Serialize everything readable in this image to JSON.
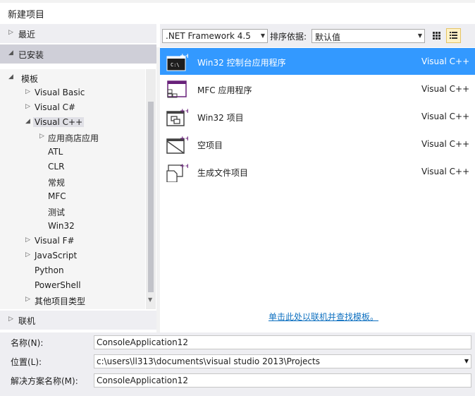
{
  "window": {
    "title": "新建项目"
  },
  "left": {
    "recent_label": "最近",
    "installed_label": "已安装",
    "online_label": "联机",
    "tree": [
      {
        "label": "模板",
        "arrow": "◢"
      },
      {
        "label": "Visual Basic",
        "arrow": "▷"
      },
      {
        "label": "Visual C#",
        "arrow": "▷"
      },
      {
        "label": "Visual C++",
        "arrow": "◢"
      },
      {
        "label": "应用商店应用",
        "arrow": "▷"
      },
      {
        "label": "ATL",
        "arrow": ""
      },
      {
        "label": "CLR",
        "arrow": ""
      },
      {
        "label": "常规",
        "arrow": ""
      },
      {
        "label": "MFC",
        "arrow": ""
      },
      {
        "label": "测试",
        "arrow": ""
      },
      {
        "label": "Win32",
        "arrow": ""
      },
      {
        "label": "Visual F#",
        "arrow": "▷"
      },
      {
        "label": "JavaScript",
        "arrow": "▷"
      },
      {
        "label": "Python",
        "arrow": ""
      },
      {
        "label": "PowerShell",
        "arrow": ""
      },
      {
        "label": "其他项目类型",
        "arrow": "▷"
      }
    ]
  },
  "toolbar": {
    "framework": ".NET Framework 4.5",
    "sort_label": "排序依据:",
    "sort_value": "默认值"
  },
  "templates": [
    {
      "name": "Win32 控制台应用程序",
      "lang": "Visual C++",
      "icon": "console-app-icon"
    },
    {
      "name": "MFC 应用程序",
      "lang": "Visual C++",
      "icon": "mfc-app-icon"
    },
    {
      "name": "Win32 项目",
      "lang": "Visual C++",
      "icon": "win32-project-icon"
    },
    {
      "name": "空项目",
      "lang": "Visual C++",
      "icon": "empty-project-icon"
    },
    {
      "name": "生成文件项目",
      "lang": "Visual C++",
      "icon": "makefile-project-icon"
    }
  ],
  "online_link": "单击此处以联机并查找模板。",
  "form": {
    "name_label": "名称(N):",
    "name_value": "ConsoleApplication12",
    "location_label": "位置(L):",
    "location_value": "c:\\users\\ll313\\documents\\visual studio 2013\\Projects",
    "solution_label": "解决方案名称(M):",
    "solution_value": "ConsoleApplication12"
  },
  "colors": {
    "selection": "#3399ff",
    "link": "#0e70c0",
    "panel": "#eeeef2"
  }
}
